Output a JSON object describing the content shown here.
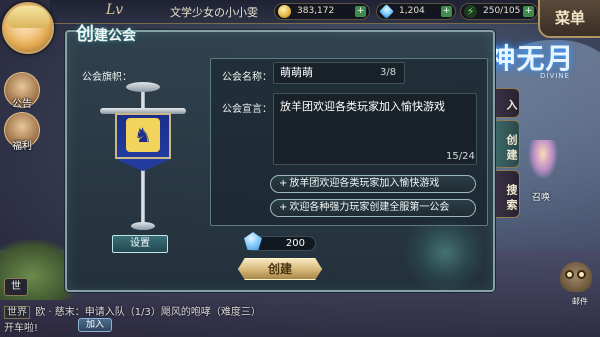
{
  "hud": {
    "level_label": "Lv",
    "player_name": "文学少女の小小雯",
    "gold": "383,172",
    "diamonds": "1,204",
    "stamina": "250/105",
    "menu_label": "菜单"
  },
  "left_menu": {
    "notice_label": "公告",
    "welfare_label": "福利",
    "chat_toggle_label": "世"
  },
  "chat": {
    "channel": "世界",
    "line1": "欧 · 慈末：申请入队（1/3）飓风的咆哮（难度三）",
    "line2": "开车啦!",
    "join_label": "加入"
  },
  "right_side": {
    "logo_text": "神无月",
    "logo_sub": "DIVINE",
    "tab_create": "创建",
    "tab_search": "搜索",
    "tab_partial": "入",
    "npc_name": "召唤",
    "owl_label": "邮件"
  },
  "panel": {
    "title_big": "创",
    "title_rest": "建公会",
    "flag_label": "公会旗帜：",
    "set_label": "设置",
    "name_label": "公会名称：",
    "name_value": "萌萌萌",
    "name_count": "3/8",
    "declaration_label": "公会宣言：",
    "declaration_value": "放羊团欢迎各类玩家加入愉快游戏",
    "declaration_count": "15/24",
    "suggestions": [
      "放羊团欢迎各类玩家加入愉快游戏",
      "欢迎各种强力玩家创建全服第一公会"
    ],
    "cost": "200",
    "create_label": "创建"
  },
  "colors": {
    "panel_bg": "#30424e",
    "panel_border": "#87a1a6",
    "flag_blue": "#223b9e",
    "emblem_gold": "#f2d35b",
    "create_gold": "#d8bb7c"
  },
  "icons": {
    "gold": "coin-icon",
    "diamond": "diamond-icon",
    "stamina": "lightning-icon",
    "emblem": "unicorn-icon"
  }
}
